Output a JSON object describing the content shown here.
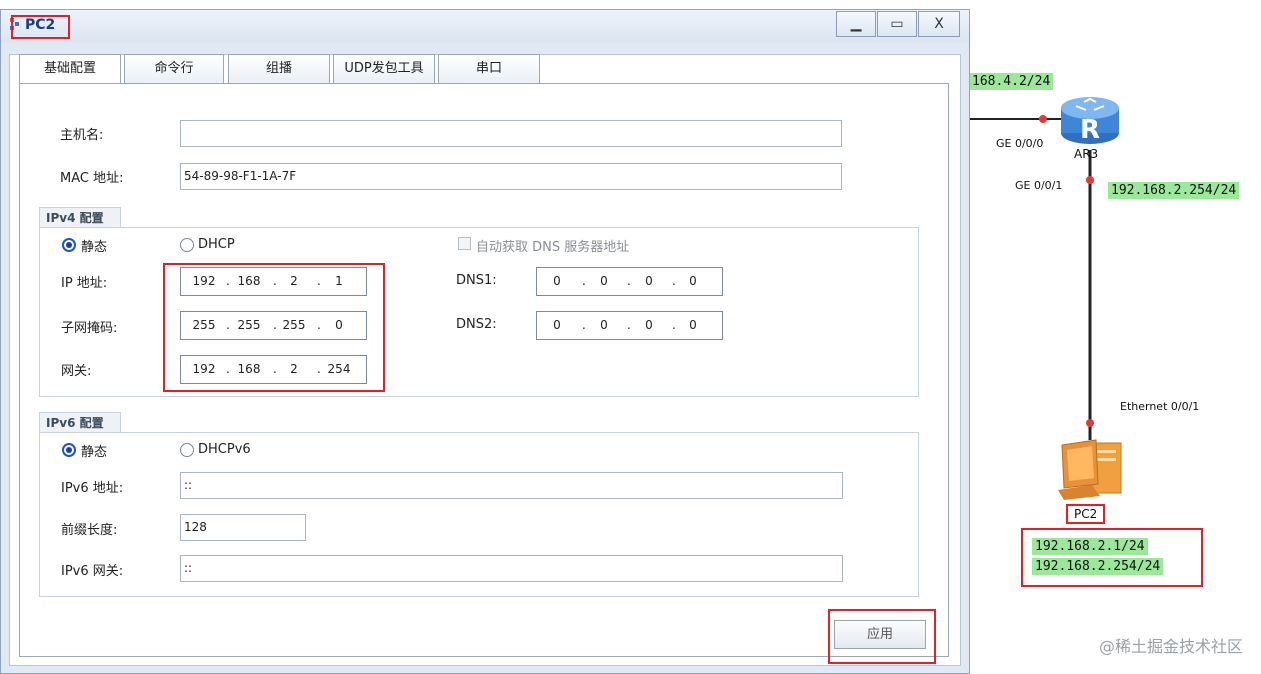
{
  "window": {
    "title": "PC2",
    "minimize_glyph": "▁",
    "maximize_glyph": "▭",
    "close_glyph": "X"
  },
  "tabs": [
    {
      "label": "基础配置",
      "active": true
    },
    {
      "label": "命令行"
    },
    {
      "label": "组播"
    },
    {
      "label": "UDP发包工具"
    },
    {
      "label": "串口"
    }
  ],
  "basic": {
    "hostname_label": "主机名:",
    "hostname_value": "",
    "mac_label": "MAC 地址:",
    "mac_value": "54-89-98-F1-1A-7F"
  },
  "ipv4": {
    "group_title": "IPv4 配置",
    "static_label": "静态",
    "dhcp_label": "DHCP",
    "selected": "静态",
    "auto_dns_label": "自动获取 DNS 服务器地址",
    "ip_label": "IP 地址:",
    "ip": [
      "192",
      "168",
      "2",
      "1"
    ],
    "mask_label": "子网掩码:",
    "mask": [
      "255",
      "255",
      "255",
      "0"
    ],
    "gateway_label": "网关:",
    "gateway": [
      "192",
      "168",
      "2",
      "254"
    ],
    "dns1_label": "DNS1:",
    "dns1": [
      "0",
      "0",
      "0",
      "0"
    ],
    "dns2_label": "DNS2:",
    "dns2": [
      "0",
      "0",
      "0",
      "0"
    ]
  },
  "ipv6": {
    "group_title": "IPv6 配置",
    "static_label": "静态",
    "dhcp_label": "DHCPv6",
    "selected": "静态",
    "addr_label": "IPv6 地址:",
    "addr_value": "::",
    "prefix_label": "前缀长度:",
    "prefix_value": "128",
    "gateway_label": "IPv6 网关:",
    "gateway_value": "::"
  },
  "apply_label": "应用",
  "topology": {
    "top_link_label": "168.4.2/24",
    "router_name": "AR3",
    "router_port_left": "GE 0/0/0",
    "router_port_down": "GE 0/0/1",
    "router_down_ip": "192.168.2.254/24",
    "pc_port": "Ethernet 0/0/1",
    "pc_name": "PC2",
    "pc_ip": "192.168.2.1/24",
    "pc_gateway": "192.168.2.254/24"
  },
  "watermark": "@稀土掘金技术社区",
  "colors": {
    "ip_label_bg": "#9be89b",
    "annotation_red": "#e0202a",
    "link": "#222222",
    "port_dot": "#e53935"
  }
}
